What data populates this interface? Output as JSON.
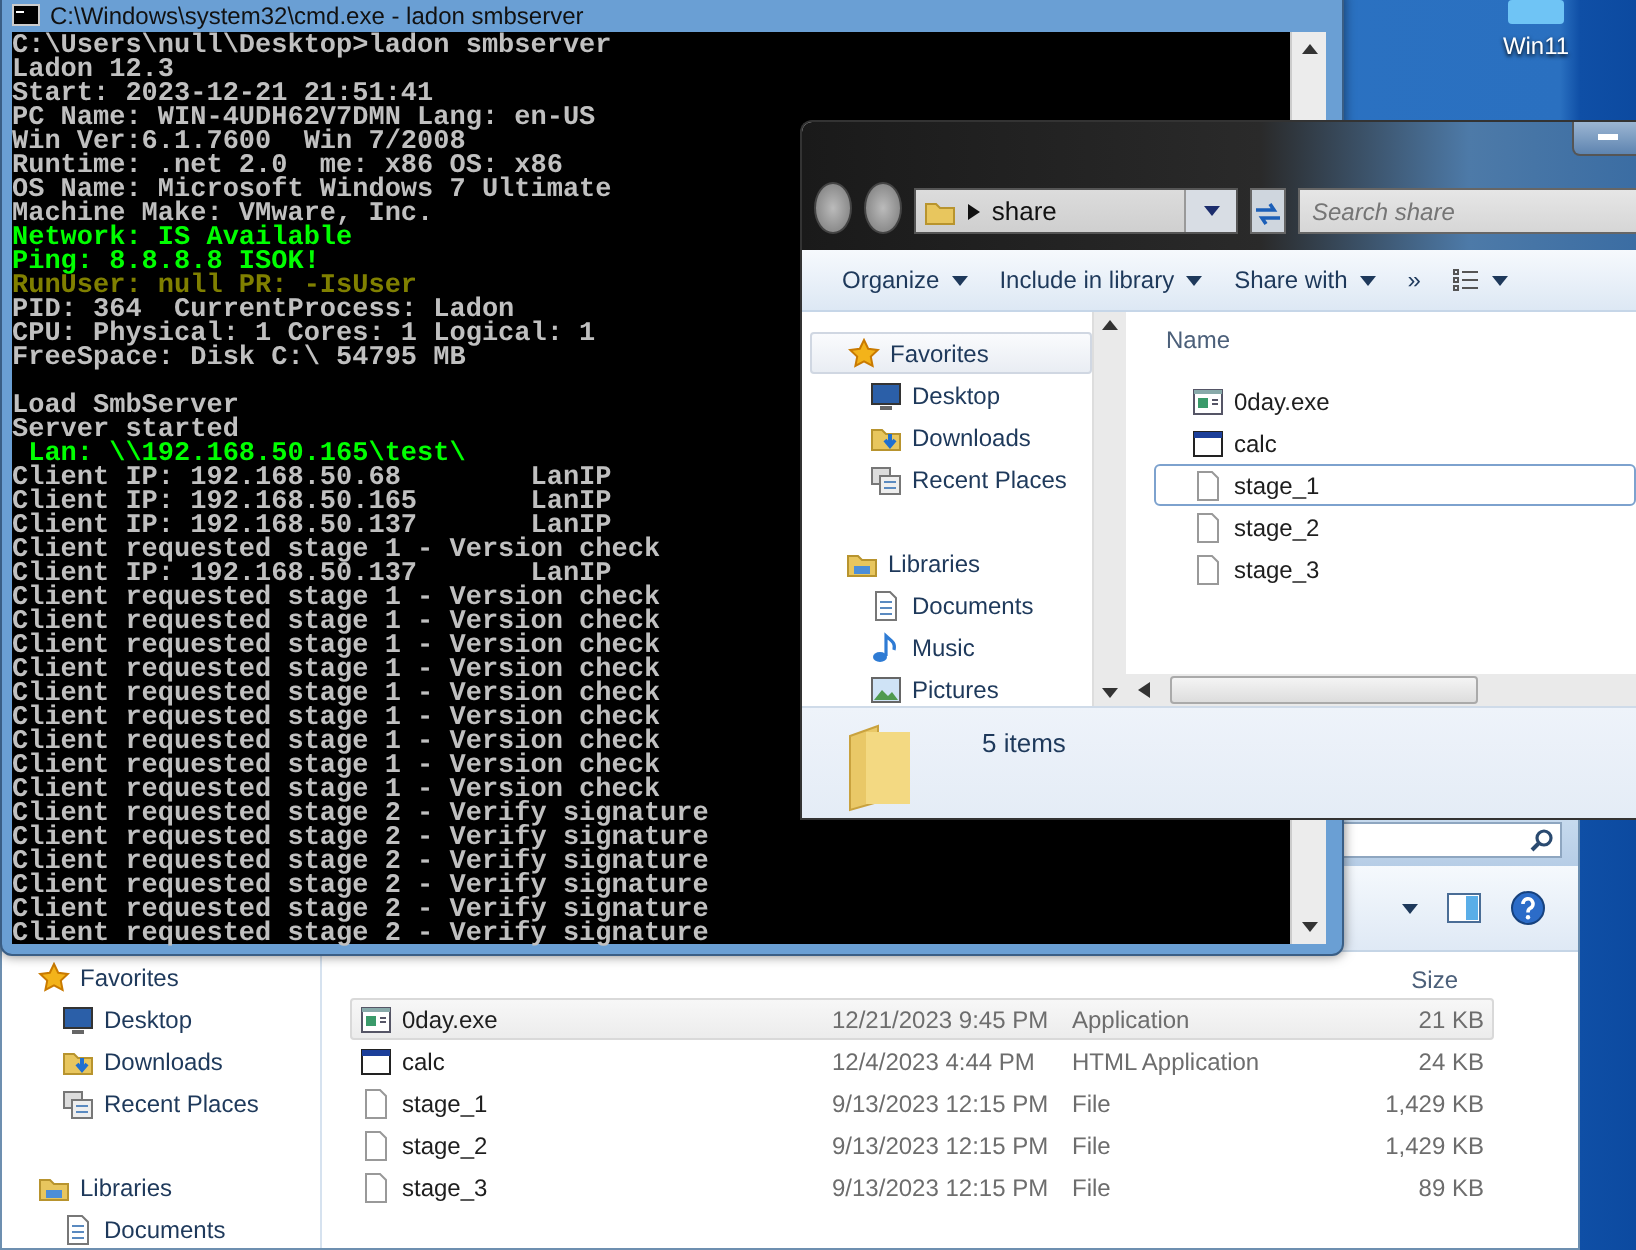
{
  "desktop": {
    "icons": [
      {
        "label": "Win11"
      }
    ]
  },
  "back_explorer": {
    "sidebar": [
      {
        "label": "Favorites",
        "kind": "star",
        "selected": false,
        "items": [
          {
            "label": "Desktop",
            "kind": "desktop",
            "selected": false
          },
          {
            "label": "Downloads",
            "kind": "downloads",
            "selected": false
          },
          {
            "label": "Recent Places",
            "kind": "recent",
            "selected": false
          }
        ]
      },
      {
        "label": "Libraries",
        "kind": "library",
        "selected": false,
        "items": [
          {
            "label": "Documents",
            "kind": "documents",
            "selected": false
          }
        ]
      }
    ],
    "columns": [
      "Size"
    ],
    "files": [
      {
        "name": "0day.exe",
        "kind": "exe",
        "date": "12/21/2023 9:45 PM",
        "type": "Application",
        "size": "21 KB",
        "selected": true
      },
      {
        "name": "calc",
        "kind": "hta",
        "date": "12/4/2023 4:44 PM",
        "type": "HTML Application",
        "size": "24 KB",
        "selected": false
      },
      {
        "name": "stage_1",
        "kind": "file",
        "date": "9/13/2023 12:15 PM",
        "type": "File",
        "size": "1,429 KB",
        "selected": false
      },
      {
        "name": "stage_2",
        "kind": "file",
        "date": "9/13/2023 12:15 PM",
        "type": "File",
        "size": "1,429 KB",
        "selected": false
      },
      {
        "name": "stage_3",
        "kind": "file",
        "date": "9/13/2023 12:15 PM",
        "type": "File",
        "size": "89 KB",
        "selected": false
      }
    ]
  },
  "cmd": {
    "title": "C:\\Windows\\system32\\cmd.exe - ladon  smbserver",
    "lines": [
      {
        "text": "C:\\Users\\null\\Desktop>ladon smbserver",
        "kind": "normal"
      },
      {
        "text": "Ladon 12.3",
        "kind": "normal"
      },
      {
        "text": "Start: 2023-12-21 21:51:41",
        "kind": "normal"
      },
      {
        "text": "PC Name: WIN-4UDH62V7DMN Lang: en-US",
        "kind": "normal"
      },
      {
        "text": "Win Ver:6.1.7600  Win 7/2008",
        "kind": "normal"
      },
      {
        "text": "Runtime: .net 2.0  me: x86 OS: x86",
        "kind": "normal"
      },
      {
        "text": "OS Name: Microsoft Windows 7 Ultimate",
        "kind": "normal"
      },
      {
        "text": "Machine Make: VMware, Inc.",
        "kind": "normal"
      },
      {
        "text": "Network: IS Available",
        "kind": "success"
      },
      {
        "text": "Ping: 8.8.8.8 ISOK!",
        "kind": "success"
      },
      {
        "text": "RunUser: null PR: -IsUser",
        "kind": "warning"
      },
      {
        "text": "PID: 364  CurrentProcess: Ladon",
        "kind": "normal"
      },
      {
        "text": "CPU: Physical: 1 Cores: 1 Logical: 1",
        "kind": "normal"
      },
      {
        "text": "FreeSpace: Disk C:\\ 54795 MB",
        "kind": "normal"
      },
      {
        "kind": "blank"
      },
      {
        "text": "Load SmbServer",
        "kind": "normal"
      },
      {
        "text": "Server started",
        "kind": "normal"
      },
      {
        "text": " Lan: \\\\192.168.50.165\\test\\",
        "kind": "success"
      },
      {
        "text": "Client IP: 192.168.50.68        LanIP",
        "kind": "normal"
      },
      {
        "text": "Client IP: 192.168.50.165       LanIP",
        "kind": "normal"
      },
      {
        "text": "Client IP: 192.168.50.137       LanIP",
        "kind": "normal"
      },
      {
        "text": "Client requested stage 1 - Version check",
        "kind": "normal"
      },
      {
        "text": "Client IP: 192.168.50.137       LanIP",
        "kind": "normal"
      },
      {
        "text": "Client requested stage 1 - Version check",
        "kind": "normal"
      },
      {
        "text": "Client requested stage 1 - Version check",
        "kind": "normal"
      },
      {
        "text": "Client requested stage 1 - Version check",
        "kind": "normal"
      },
      {
        "text": "Client requested stage 1 - Version check",
        "kind": "normal"
      },
      {
        "text": "Client requested stage 1 - Version check",
        "kind": "normal"
      },
      {
        "text": "Client requested stage 1 - Version check",
        "kind": "normal"
      },
      {
        "text": "Client requested stage 1 - Version check",
        "kind": "normal"
      },
      {
        "text": "Client requested stage 1 - Version check",
        "kind": "normal"
      },
      {
        "text": "Client requested stage 1 - Version check",
        "kind": "normal"
      },
      {
        "text": "Client requested stage 2 - Verify signature",
        "kind": "normal"
      },
      {
        "text": "Client requested stage 2 - Verify signature",
        "kind": "normal"
      },
      {
        "text": "Client requested stage 2 - Verify signature",
        "kind": "normal"
      },
      {
        "text": "Client requested stage 2 - Verify signature",
        "kind": "normal"
      },
      {
        "text": "Client requested stage 2 - Verify signature",
        "kind": "normal"
      },
      {
        "text": "Client requested stage 2 - Verify signature",
        "kind": "normal"
      }
    ]
  },
  "explorer": {
    "address": "share",
    "search_placeholder": "Search share",
    "toolbar": [
      {
        "label": "Organize"
      },
      {
        "label": "Include in library"
      },
      {
        "label": "Share with"
      }
    ],
    "overflow": "»",
    "sidebar": [
      {
        "label": "Favorites",
        "kind": "star",
        "selected": true,
        "items": [
          {
            "label": "Desktop",
            "kind": "desktop",
            "selected": false
          },
          {
            "label": "Downloads",
            "kind": "downloads",
            "selected": false
          },
          {
            "label": "Recent Places",
            "kind": "recent",
            "selected": false
          }
        ]
      },
      {
        "label": "Libraries",
        "kind": "library",
        "selected": false,
        "items": [
          {
            "label": "Documents",
            "kind": "documents",
            "selected": false
          },
          {
            "label": "Music",
            "kind": "music",
            "selected": false
          },
          {
            "label": "Pictures",
            "kind": "pictures",
            "selected": false
          }
        ]
      }
    ],
    "column": "Name",
    "files": [
      {
        "name": "0day.exe",
        "kind": "exe",
        "focused": false
      },
      {
        "name": "calc",
        "kind": "hta",
        "focused": false
      },
      {
        "name": "stage_1",
        "kind": "file",
        "focused": true
      },
      {
        "name": "stage_2",
        "kind": "file",
        "focused": false
      },
      {
        "name": "stage_3",
        "kind": "file",
        "focused": false
      }
    ],
    "status": "5 items"
  }
}
